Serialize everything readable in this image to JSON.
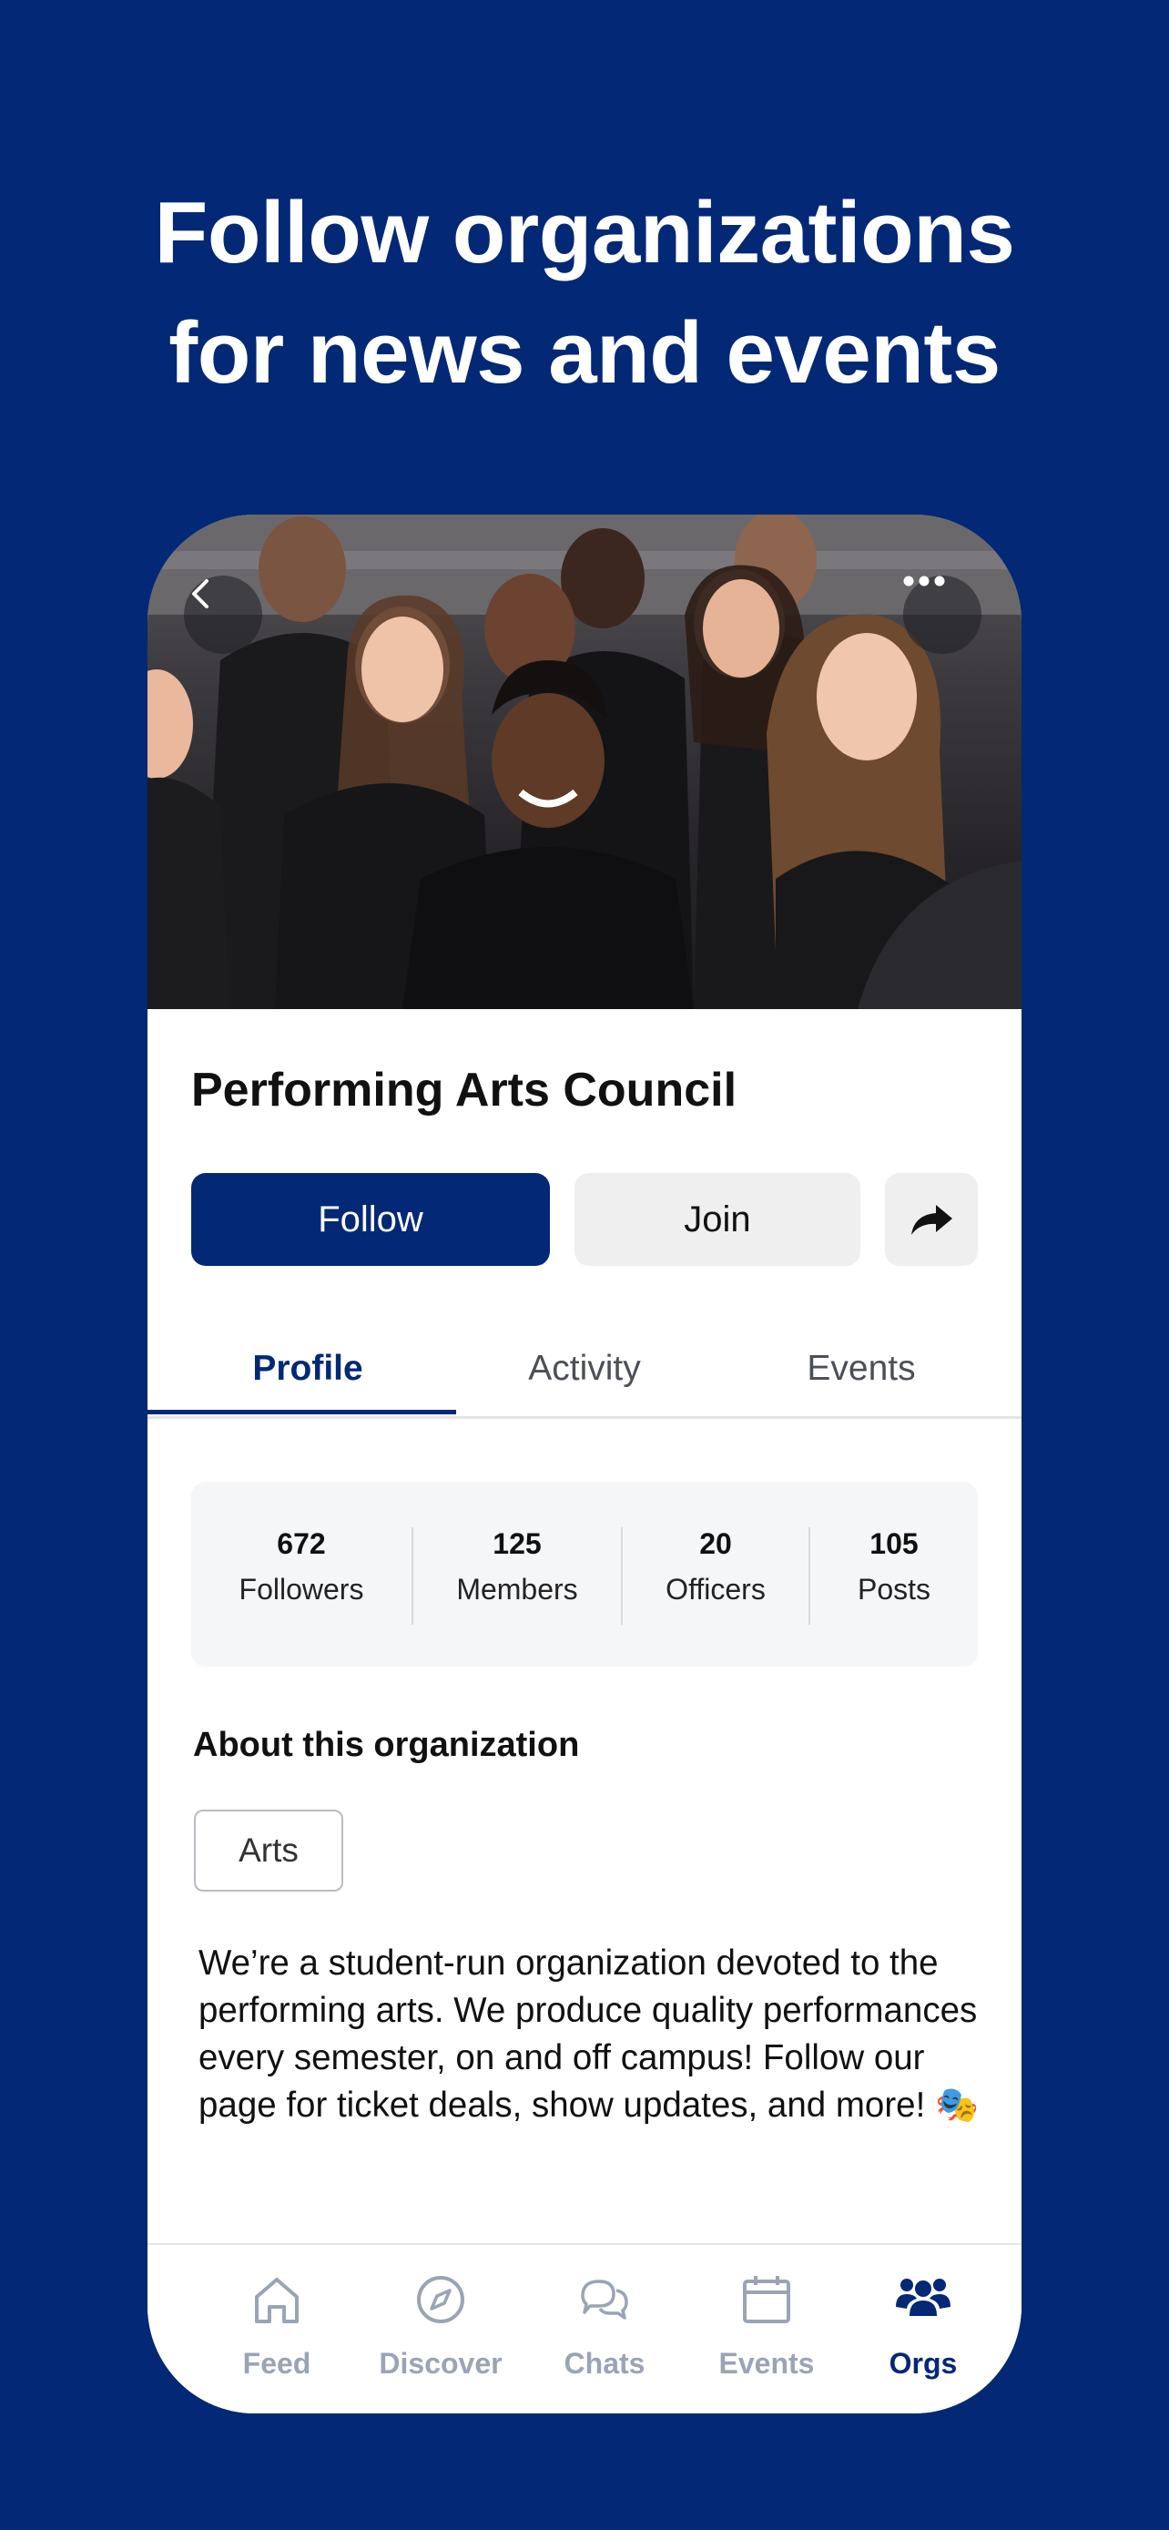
{
  "headline": {
    "line1": "Follow organizations",
    "line2": "for news and events"
  },
  "colors": {
    "background": "#032875",
    "primary": "#032875",
    "inactive": "#9aa4b4"
  },
  "hero": {
    "back_icon": "chevron-left-icon",
    "more_icon": "more-horizontal-icon"
  },
  "org": {
    "name": "Performing Arts Council",
    "follow_label": "Follow",
    "join_label": "Join",
    "share_icon": "share-arrow-icon"
  },
  "tabs": [
    {
      "label": "Profile",
      "active": true
    },
    {
      "label": "Activity",
      "active": false
    },
    {
      "label": "Events",
      "active": false
    }
  ],
  "stats": [
    {
      "value": "672",
      "label": "Followers"
    },
    {
      "value": "125",
      "label": "Members"
    },
    {
      "value": "20",
      "label": "Officers"
    },
    {
      "value": "105",
      "label": "Posts"
    }
  ],
  "about": {
    "title": "About this organization",
    "tag": "Arts",
    "description": "We’re a student-run organization devoted to the performing arts. We produce quality performances every semester, on and off campus! Follow our page for ticket deals, show updates, and more! 🎭"
  },
  "nav": [
    {
      "label": "Feed",
      "icon": "home-icon",
      "active": false
    },
    {
      "label": "Discover",
      "icon": "compass-icon",
      "active": false
    },
    {
      "label": "Chats",
      "icon": "chat-bubbles-icon",
      "active": false
    },
    {
      "label": "Events",
      "icon": "calendar-icon",
      "active": false
    },
    {
      "label": "Orgs",
      "icon": "people-group-icon",
      "active": true
    }
  ]
}
